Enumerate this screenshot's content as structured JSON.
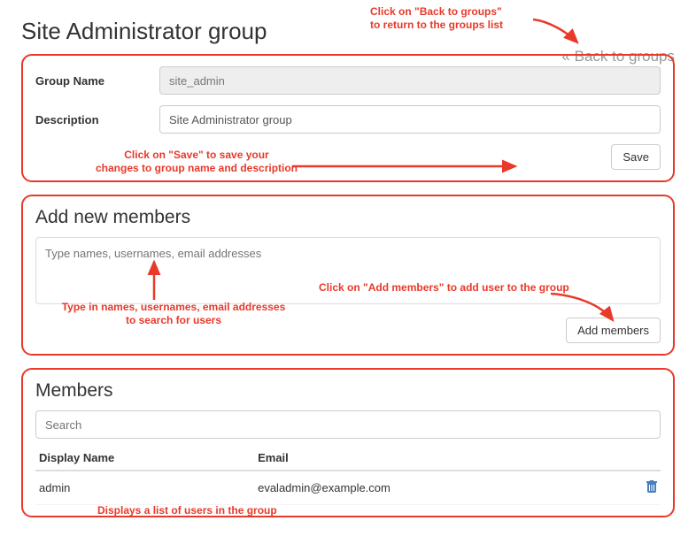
{
  "header": {
    "title": "Site Administrator group",
    "back_link": "«  Back to groups"
  },
  "group_form": {
    "name_label": "Group Name",
    "name_value": "site_admin",
    "desc_label": "Description",
    "desc_value": "Site Administrator group",
    "save_label": "Save"
  },
  "add_members": {
    "heading": "Add new members",
    "placeholder": "Type names, usernames, email addresses",
    "button_label": "Add members"
  },
  "members": {
    "heading": "Members",
    "search_placeholder": "Search",
    "col_display_name": "Display Name",
    "col_email": "Email",
    "rows": [
      {
        "display_name": "admin",
        "email": "evaladmin@example.com"
      }
    ]
  },
  "annotations": {
    "back": "Click on \"Back to groups\"\nto return to the groups list",
    "save": "Click on \"Save\" to save your\nchanges to group name and description",
    "type_search": "Type in names, usernames, email addresses\nto search for users",
    "add_members": "Click on \"Add members\" to add user to the group",
    "members_list": "Displays a list of users in the group"
  }
}
